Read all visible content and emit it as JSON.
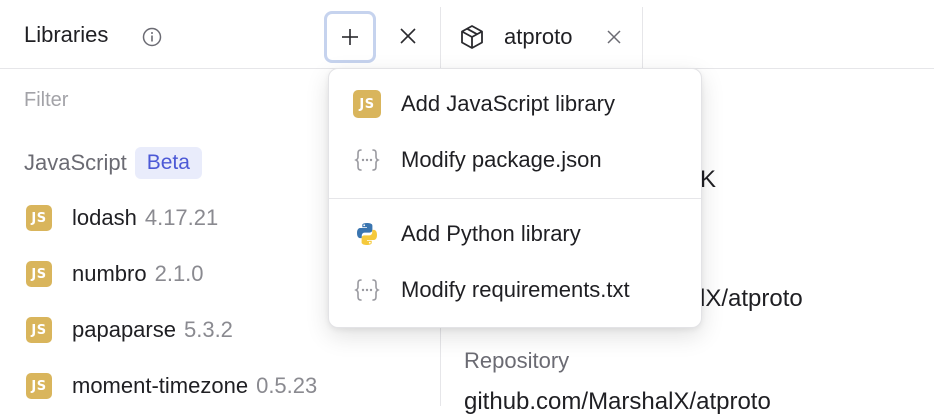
{
  "header": {
    "title": "Libraries",
    "add_symbol": "+",
    "tab": {
      "label": "atproto"
    }
  },
  "sidebar": {
    "filter_placeholder": "Filter",
    "section": {
      "label": "JavaScript",
      "badge": "Beta"
    },
    "items": [
      {
        "icon": "JS",
        "name": "lodash",
        "version": "4.17.21"
      },
      {
        "icon": "JS",
        "name": "numbro",
        "version": "2.1.0"
      },
      {
        "icon": "JS",
        "name": "papaparse",
        "version": "5.3.2"
      },
      {
        "icon": "JS",
        "name": "moment-timezone",
        "version": "0.5.23"
      }
    ]
  },
  "main": {
    "partial_1": "K",
    "partial_2": "lX/atproto",
    "repository_label": "Repository",
    "repository_value": "github.com/MarshalX/atproto"
  },
  "menu": {
    "items": [
      {
        "icon": "js-icon",
        "icon_text": "JS",
        "label": "Add JavaScript library"
      },
      {
        "icon": "json-braces-icon",
        "label": "Modify package.json"
      },
      {
        "icon": "python-icon",
        "label": "Add Python library"
      },
      {
        "icon": "braces-icon",
        "label": "Modify requirements.txt"
      }
    ]
  },
  "colors": {
    "js_badge": "#d9b55c",
    "beta_bg": "#e9ecfb",
    "beta_text": "#4c59d6",
    "focus_ring": "#c6d3ee"
  }
}
